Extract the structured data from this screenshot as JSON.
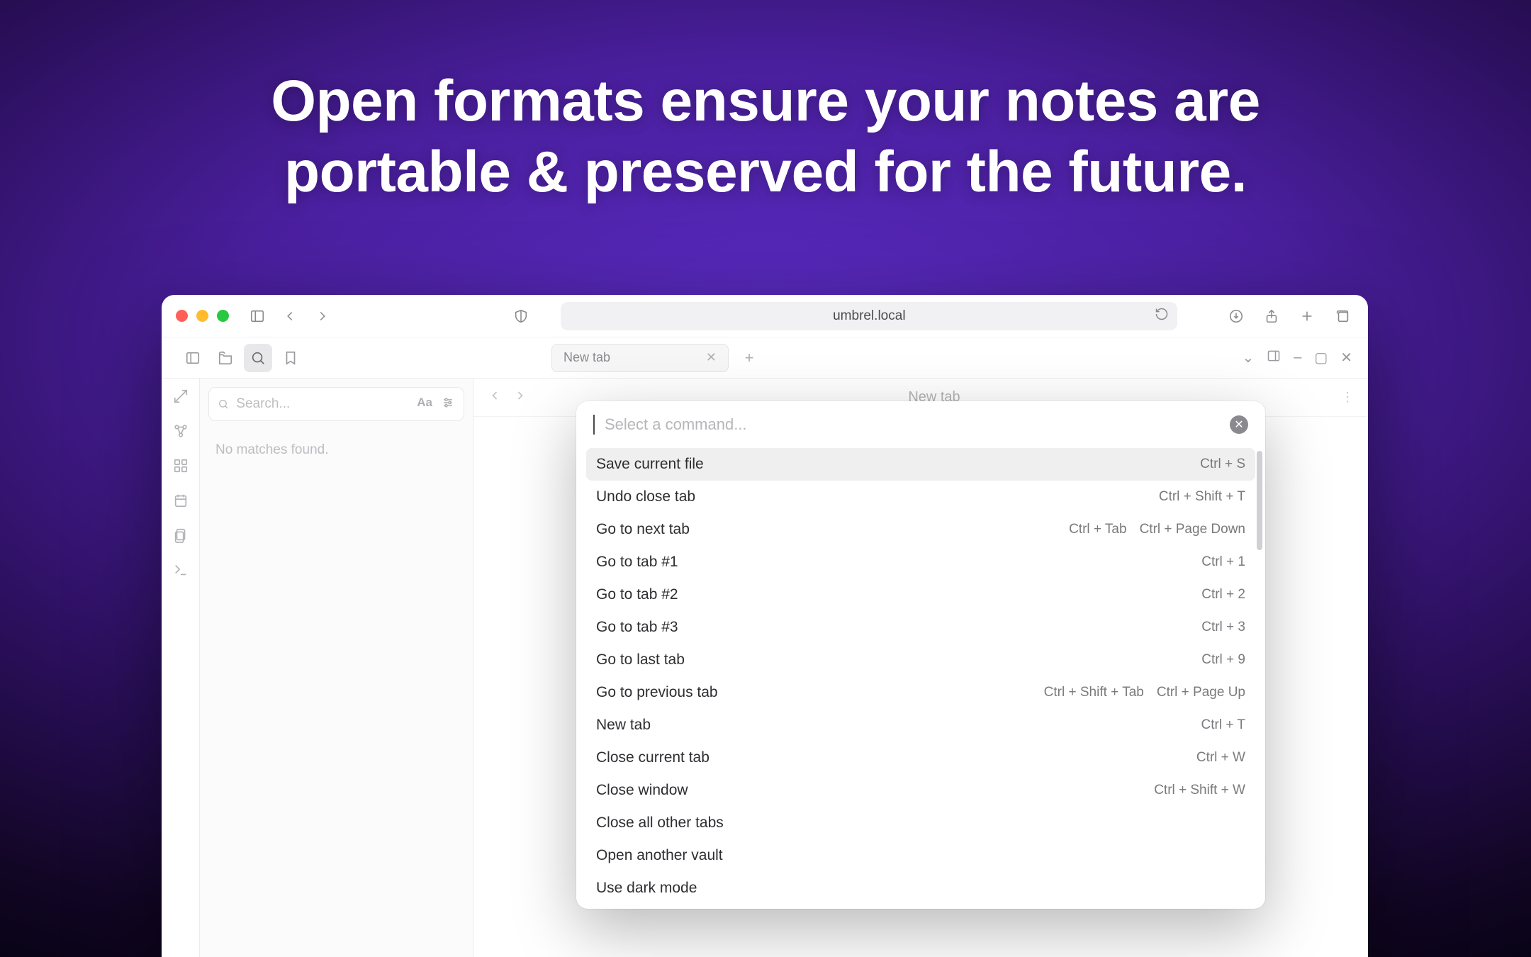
{
  "headline": {
    "line1": "Open formats ensure your notes are",
    "line2": "portable & preserved for the future."
  },
  "browser": {
    "url": "umbrel.local"
  },
  "tabs": {
    "items": [
      {
        "label": "New tab"
      }
    ]
  },
  "window_controls": {
    "minimize": "–",
    "maximize": "▢",
    "close": "✕"
  },
  "sidebar": {
    "search_placeholder": "Search...",
    "no_matches": "No matches found."
  },
  "content": {
    "title": "New tab"
  },
  "palette": {
    "placeholder": "Select a command...",
    "commands": [
      {
        "label": "Save current file",
        "keys": [
          "Ctrl + S"
        ],
        "selected": true
      },
      {
        "label": "Undo close tab",
        "keys": [
          "Ctrl + Shift + T"
        ]
      },
      {
        "label": "Go to next tab",
        "keys": [
          "Ctrl + Tab",
          "Ctrl + Page Down"
        ]
      },
      {
        "label": "Go to tab #1",
        "keys": [
          "Ctrl + 1"
        ]
      },
      {
        "label": "Go to tab #2",
        "keys": [
          "Ctrl + 2"
        ]
      },
      {
        "label": "Go to tab #3",
        "keys": [
          "Ctrl + 3"
        ]
      },
      {
        "label": "Go to last tab",
        "keys": [
          "Ctrl + 9"
        ]
      },
      {
        "label": "Go to previous tab",
        "keys": [
          "Ctrl + Shift + Tab",
          "Ctrl + Page Up"
        ]
      },
      {
        "label": "New tab",
        "keys": [
          "Ctrl + T"
        ]
      },
      {
        "label": "Close current tab",
        "keys": [
          "Ctrl + W"
        ]
      },
      {
        "label": "Close window",
        "keys": [
          "Ctrl + Shift + W"
        ]
      },
      {
        "label": "Close all other tabs",
        "keys": []
      },
      {
        "label": "Open another vault",
        "keys": []
      },
      {
        "label": "Use dark mode",
        "keys": []
      }
    ]
  }
}
